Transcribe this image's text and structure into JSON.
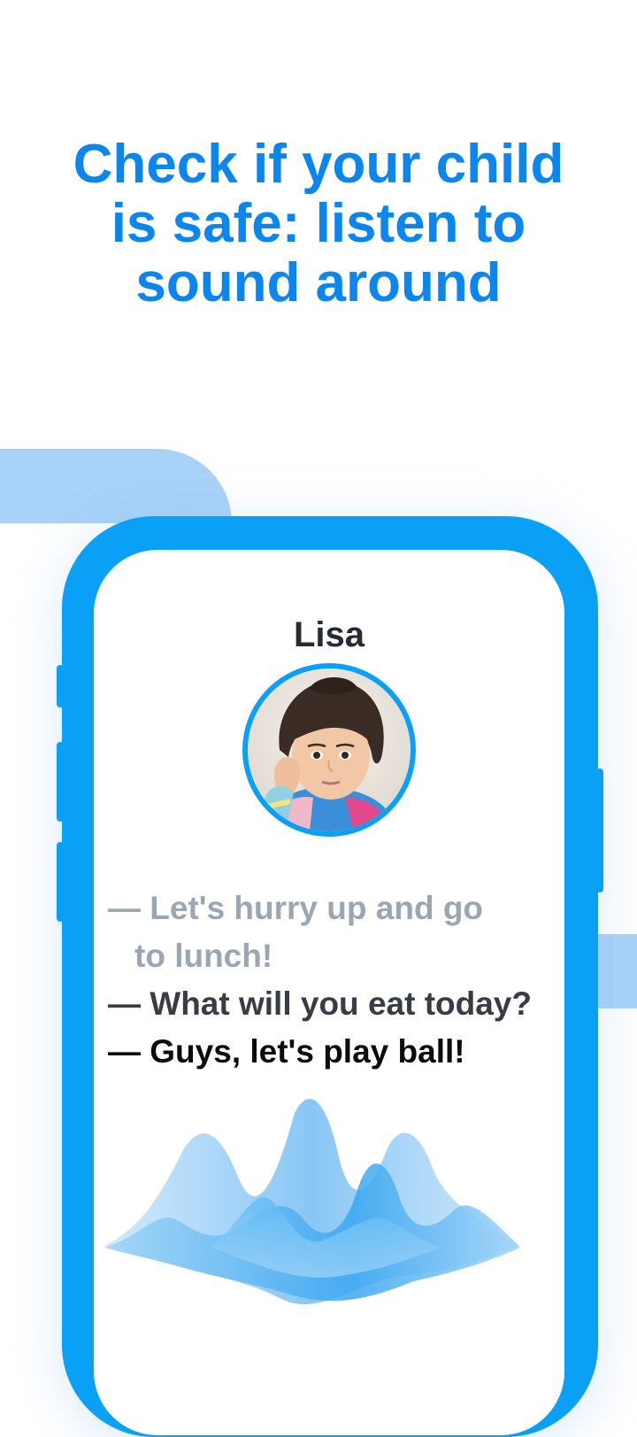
{
  "headline": {
    "line1": "Check if your child",
    "line2": "is safe: listen to",
    "line3": "sound around"
  },
  "phone": {
    "contact_name": "Lisa",
    "avatar_icon": "child-photo-avatar",
    "transcript": {
      "line1a": "— Let's hurry up and go",
      "line1b": "to lunch!",
      "line2": "— What will you eat today?",
      "line3": "— Guys, let's play ball!"
    },
    "waveform_icon": "audio-waveform"
  },
  "colors": {
    "accent": "#0a86ee",
    "phone_frame": "#0aa0f5",
    "light_blue": "#a9d2f8",
    "faded_text": "#9aa6b3",
    "mid_text": "#383d45",
    "dark_text": "#0b0c0e"
  }
}
